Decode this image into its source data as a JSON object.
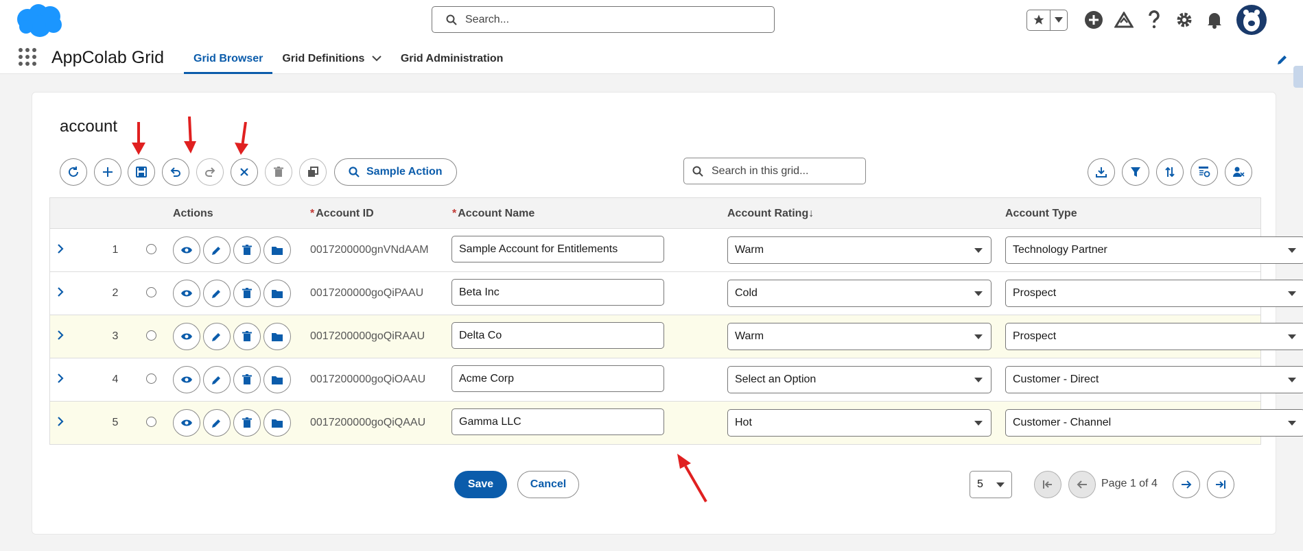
{
  "header": {
    "search_placeholder": "Search...",
    "app_name": "AppColab Grid",
    "tabs": [
      {
        "label": "Grid Browser",
        "active": true
      },
      {
        "label": "Grid Definitions",
        "active": false
      },
      {
        "label": "Grid Administration",
        "active": false
      }
    ],
    "icons": [
      "favorites-star-icon",
      "favorites-dropdown-icon",
      "global-add-icon",
      "trailhead-icon",
      "help-icon",
      "setup-gear-icon",
      "notifications-bell-icon",
      "user-avatar"
    ]
  },
  "grid": {
    "title": "account",
    "toolbar": {
      "sample_action_label": "Sample Action",
      "search_placeholder": "Search in this grid...",
      "left_buttons": [
        "refresh-icon",
        "add-icon",
        "save-icon",
        "undo-icon",
        "redo-icon",
        "cancel-x-icon",
        "delete-icon",
        "clone-icon"
      ],
      "right_buttons": [
        "download-icon",
        "filter-icon",
        "sort-icon",
        "column-settings-icon",
        "user-remove-icon"
      ]
    },
    "columns": {
      "actions": "Actions",
      "account_id": "Account ID",
      "account_name": "Account Name",
      "account_rating": "Account Rating",
      "account_type": "Account Type",
      "required_marker": "*",
      "sort_indicator": "↓"
    },
    "rows": [
      {
        "num": "1",
        "id": "0017200000gnVNdAAM",
        "name": "Sample Account for Entitlements",
        "rating": "Warm",
        "type": "Technology Partner"
      },
      {
        "num": "2",
        "id": "0017200000goQiPAAU",
        "name": "Beta Inc",
        "rating": "Cold",
        "type": "Prospect"
      },
      {
        "num": "3",
        "id": "0017200000goQiRAAU",
        "name": "Delta Co",
        "rating": "Warm",
        "type": "Prospect"
      },
      {
        "num": "4",
        "id": "0017200000goQiOAAU",
        "name": "Acme Corp",
        "rating": "Select an Option",
        "type": "Customer - Direct"
      },
      {
        "num": "5",
        "id": "0017200000goQiQAAU",
        "name": "Gamma LLC",
        "rating": "Hot",
        "type": "Customer - Channel"
      }
    ],
    "footer": {
      "save_label": "Save",
      "cancel_label": "Cancel",
      "page_size": "5",
      "page_info": "Page 1 of 4"
    }
  },
  "colors": {
    "brand_blue": "#0b5cab",
    "annotation_red": "#e02020",
    "alt_row": "#fcfcea"
  }
}
